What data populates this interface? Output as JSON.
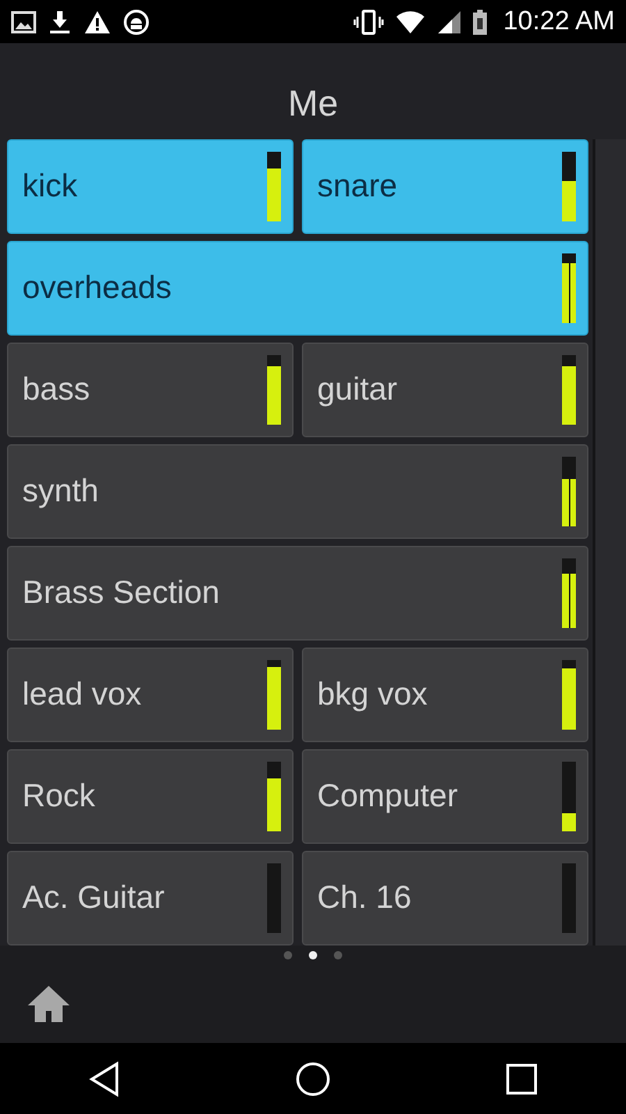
{
  "status_bar": {
    "time": "10:22 AM"
  },
  "header": {
    "title": "Me"
  },
  "channels": [
    {
      "name": "kick",
      "kind": "mono",
      "selected": true,
      "level": 0.75
    },
    {
      "name": "snare",
      "kind": "mono",
      "selected": true,
      "level": 0.58
    },
    {
      "name": "overheads",
      "kind": "stereo",
      "selected": true,
      "level": 0.85
    },
    {
      "name": "bass",
      "kind": "mono",
      "selected": false,
      "level": 0.83
    },
    {
      "name": "guitar",
      "kind": "mono",
      "selected": false,
      "level": 0.83
    },
    {
      "name": "synth",
      "kind": "stereo",
      "selected": false,
      "level": 0.68
    },
    {
      "name": "Brass Section",
      "kind": "stereo",
      "selected": false,
      "level": 0.78
    },
    {
      "name": "lead vox",
      "kind": "mono",
      "selected": false,
      "level": 0.9
    },
    {
      "name": "bkg vox",
      "kind": "mono",
      "selected": false,
      "level": 0.88
    },
    {
      "name": "Rock",
      "kind": "mono",
      "selected": false,
      "level": 0.75
    },
    {
      "name": "Computer",
      "kind": "mono",
      "selected": false,
      "level": 0.25
    },
    {
      "name": "Ac. Guitar",
      "kind": "mono",
      "selected": false,
      "level": 0
    },
    {
      "name": "Ch. 16",
      "kind": "mono",
      "selected": false,
      "level": 0
    }
  ],
  "pages": [
    {
      "selected": false
    },
    {
      "selected": true
    },
    {
      "selected": false
    }
  ]
}
